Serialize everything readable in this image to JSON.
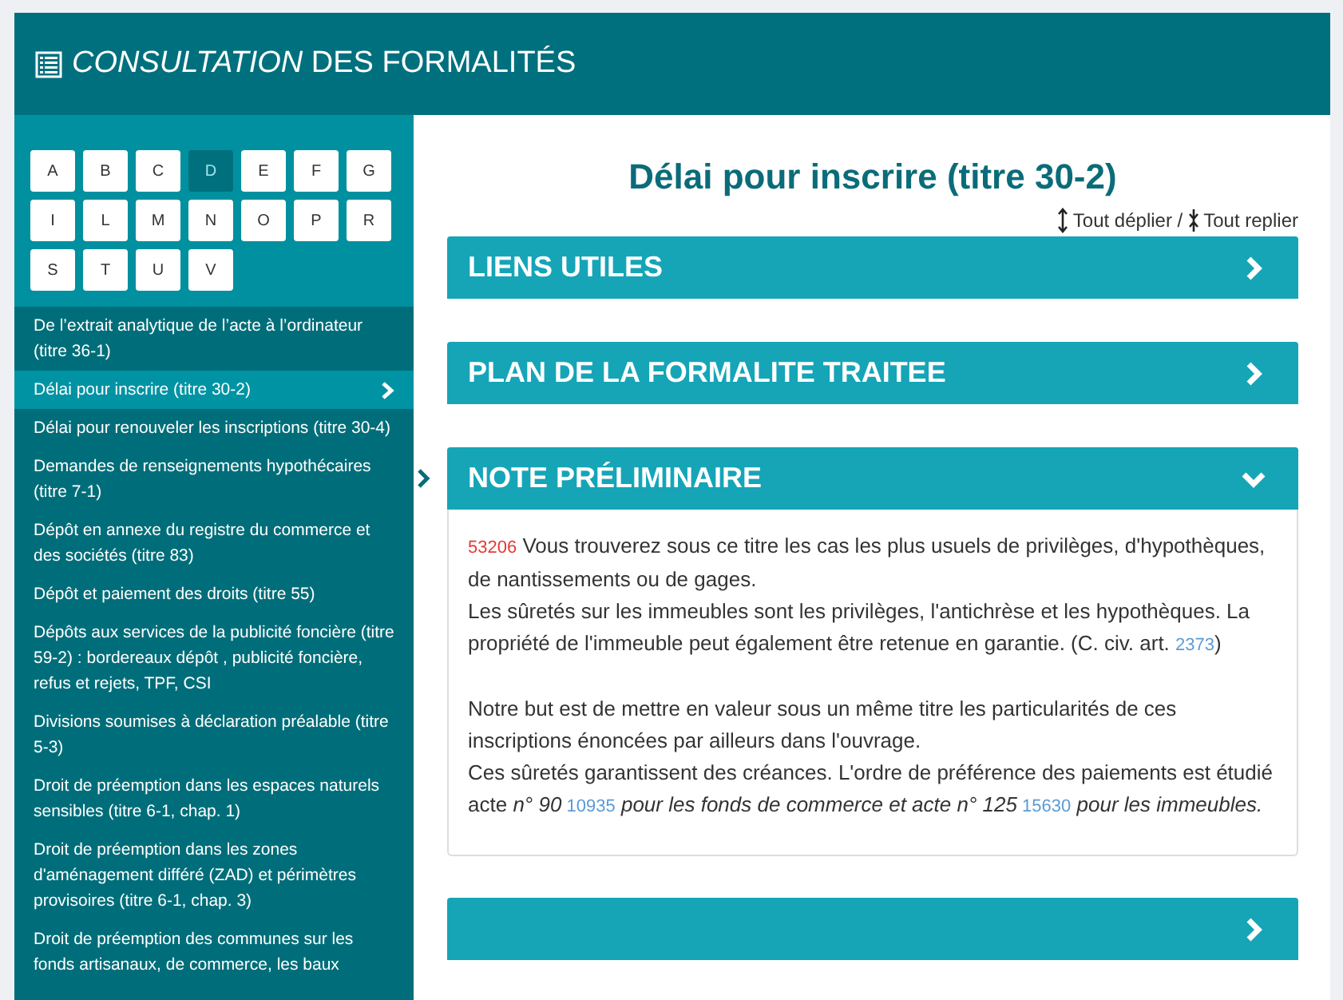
{
  "header": {
    "title_italic": "CONSULTATION",
    "title_rest": "DES FORMALITÉS"
  },
  "letters": [
    {
      "label": "A",
      "selected": false
    },
    {
      "label": "B",
      "selected": false
    },
    {
      "label": "C",
      "selected": false
    },
    {
      "label": "D",
      "selected": true
    },
    {
      "label": "E",
      "selected": false
    },
    {
      "label": "F",
      "selected": false
    },
    {
      "label": "G",
      "selected": false
    },
    {
      "label": "I",
      "selected": false
    },
    {
      "label": "L",
      "selected": false
    },
    {
      "label": "M",
      "selected": false
    },
    {
      "label": "N",
      "selected": false
    },
    {
      "label": "O",
      "selected": false
    },
    {
      "label": "P",
      "selected": false
    },
    {
      "label": "R",
      "selected": false
    },
    {
      "label": "S",
      "selected": false
    },
    {
      "label": "T",
      "selected": false
    },
    {
      "label": "U",
      "selected": false
    },
    {
      "label": "V",
      "selected": false
    }
  ],
  "sidebar": {
    "items": [
      {
        "label": "De l’extrait analytique de l’acte à l’ordinateur (titre 36-1)",
        "selected": false
      },
      {
        "label": "Délai pour inscrire (titre 30-2)",
        "selected": true
      },
      {
        "label": "Délai pour renouveler les inscriptions (titre 30-4)",
        "selected": false
      },
      {
        "label": "Demandes de renseignements hypothécaires (titre 7-1)",
        "selected": false
      },
      {
        "label": "Dépôt en annexe du registre du commerce et des sociétés (titre 83)",
        "selected": false
      },
      {
        "label": "Dépôt et paiement des droits (titre 55)",
        "selected": false
      },
      {
        "label": "Dépôts aux services de la publicité foncière (titre 59-2) : bordereaux dépôt , publicité foncière, refus et rejets, TPF, CSI",
        "selected": false
      },
      {
        "label": "Divisions soumises à déclaration préalable (titre 5-3)",
        "selected": false
      },
      {
        "label": "Droit de préemption dans les espaces naturels sensibles (titre 6-1, chap. 1)",
        "selected": false
      },
      {
        "label": "Droit de préemption dans les zones d'aménagement différé (ZAD) et périmètres provisoires (titre 6-1, chap. 3)",
        "selected": false
      },
      {
        "label": "Droit de préemption des communes sur les fonds artisanaux, de commerce, les baux",
        "selected": false
      }
    ]
  },
  "page": {
    "title": "Délai pour inscrire (titre 30-2)",
    "expand_all": "Tout déplier /",
    "collapse_all": "Tout replier"
  },
  "sections": [
    {
      "title": "LIENS UTILES",
      "expanded": false,
      "current": false
    },
    {
      "title": "PLAN DE LA FORMALITE TRAITEE",
      "expanded": false,
      "current": false
    },
    {
      "title": "NOTE PRÉLIMINAIRE",
      "expanded": true,
      "current": true,
      "paragraphs": [
        [
          [
            {
              "kind": "ref",
              "text": "53206"
            },
            {
              "kind": "text",
              "text": " Vous trouverez sous ce titre les cas les plus usuels de privilèges, d'hypothèques, de nantissements ou de gages."
            }
          ],
          [
            {
              "kind": "text",
              "text": "Les sûretés sur les immeubles sont les privilèges, l'antichrèse et les hypothèques. La propriété de l'immeuble peut également être retenue en garantie. (C. civ. art. "
            },
            {
              "kind": "link",
              "text": "2373"
            },
            {
              "kind": "text",
              "text": ")"
            }
          ]
        ],
        [
          [
            {
              "kind": "text",
              "text": "Notre but est de mettre en valeur sous un même titre les particularités de ces inscriptions énoncées par ailleurs dans l'ouvrage."
            }
          ],
          [
            {
              "kind": "text",
              "text": "Ces sûretés garantissent des créances. L'ordre de préférence des paiements est étudié acte "
            },
            {
              "kind": "italic",
              "text": "n° 90"
            },
            {
              "kind": "link",
              "text": " 10935"
            },
            {
              "kind": "italic",
              "text": " pour les fonds de commerce et acte n° 125"
            },
            {
              "kind": "link",
              "text": " 15630"
            },
            {
              "kind": "italic",
              "text": " pour les immeubles."
            }
          ]
        ]
      ]
    },
    {
      "expanded": false,
      "current": false
    }
  ]
}
